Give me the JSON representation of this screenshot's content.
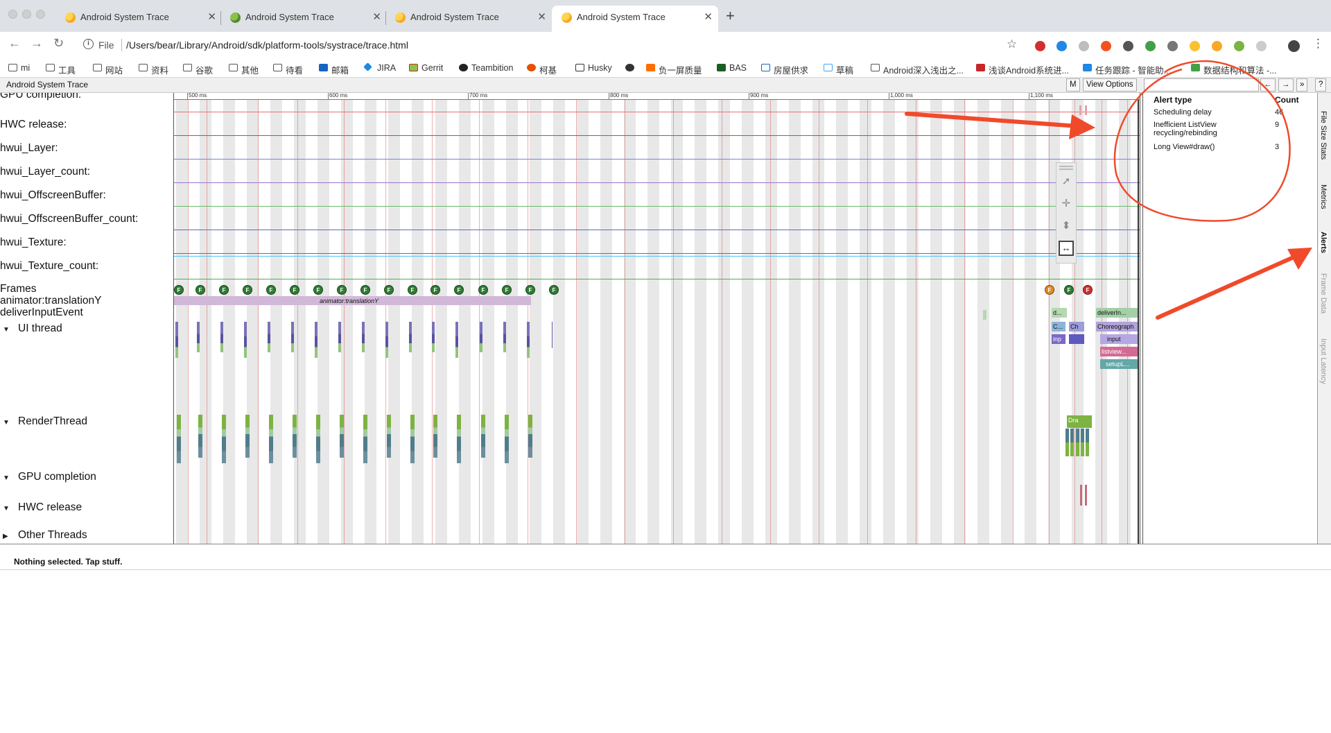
{
  "browser": {
    "tabs": [
      {
        "title": "Android System Trace"
      },
      {
        "title": "Android System Trace"
      },
      {
        "title": "Android System Trace"
      },
      {
        "title": "Android System Trace"
      }
    ],
    "close_glyph": "✕",
    "new_tab_glyph": "+",
    "url_scheme": "File",
    "url": "/Users/bear/Library/Android/sdk/platform-tools/systrace/trace.html",
    "bookmarks": [
      {
        "label": "mi"
      },
      {
        "label": "工具"
      },
      {
        "label": "网站"
      },
      {
        "label": "资料"
      },
      {
        "label": "谷歌"
      },
      {
        "label": "其他"
      },
      {
        "label": "待看"
      },
      {
        "label": "邮箱"
      },
      {
        "label": "JIRA"
      },
      {
        "label": "Gerrit"
      },
      {
        "label": "Teambition"
      },
      {
        "label": "柯基"
      },
      {
        "label": "Husky"
      },
      {
        "label": ""
      },
      {
        "label": "负一屏质量"
      },
      {
        "label": "BAS"
      },
      {
        "label": "房屋供求"
      },
      {
        "label": "草稿"
      },
      {
        "label": "Android深入浅出之..."
      },
      {
        "label": "浅谈Android系统进..."
      },
      {
        "label": "任务跟踪 - 智能助..."
      },
      {
        "label": "数据结构和算法 -..."
      }
    ]
  },
  "app": {
    "title": "Android System Trace",
    "m_button": "M",
    "view_options": "View Options",
    "nav_prev": "←",
    "nav_next": "→",
    "nav_more": "»",
    "help": "?"
  },
  "ruler": {
    "ticks": [
      "500 ms",
      "600 ms",
      "700 ms",
      "800 ms",
      "900 ms",
      "1,000 ms",
      "1,100 ms"
    ]
  },
  "tracks": {
    "partial_top": "GPU completion:",
    "hwc_release": "HWC release:",
    "hwui_layer": "hwui_Layer:",
    "hwui_layer_count": "hwui_Layer_count:",
    "hwui_offscreen": "hwui_OffscreenBuffer:",
    "hwui_offscreen_count": "hwui_OffscreenBuffer_count:",
    "hwui_texture": "hwui_Texture:",
    "hwui_texture_count": "hwui_Texture_count:",
    "frames": "Frames",
    "animator": "animator:translationY",
    "deliver": "deliverInputEvent",
    "ui_thread": "UI thread",
    "render_thread": "RenderThread",
    "gpu_completion": "GPU completion",
    "hwc_group": "HWC release",
    "other_threads": "Other Threads"
  },
  "slices": {
    "animator": "animator:translationY",
    "d_short": "d...",
    "deliver_short": "deliverIn...",
    "c_short": "C...",
    "ch": "Ch",
    "choreographer": "Choreograph",
    "inp": "inp",
    "input": "input",
    "listview": "listview...",
    "setup": "setupL...",
    "dra": "Dra"
  },
  "frame_marker": "F",
  "alerts": {
    "header_type": "Alert type",
    "header_count": "Count",
    "rows": [
      {
        "type": "Scheduling delay",
        "count": "46"
      },
      {
        "type": "Inefficient ListView recycling/rebinding",
        "count": "9"
      },
      {
        "type": "Long View#draw()",
        "count": "3"
      }
    ]
  },
  "side_tabs": [
    "File Size Stats",
    "Metrics",
    "Alerts",
    "Frame Data",
    "Input Latency"
  ],
  "status": "Nothing selected. Tap stuff.",
  "colors": {
    "frame_good": "#2e7d32",
    "frame_warn": "#e08a1e",
    "frame_bad": "#d32f2f",
    "annotation": "#f04a2a",
    "slice_purple": "#8c7fc0",
    "slice_green": "#7cb342"
  }
}
